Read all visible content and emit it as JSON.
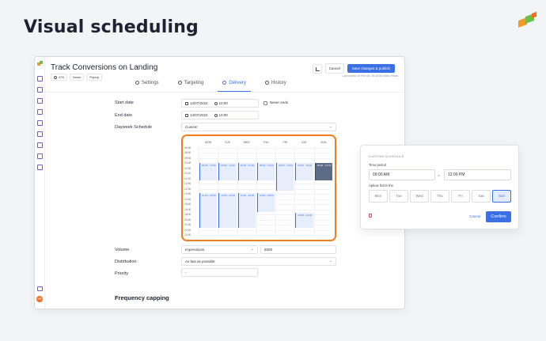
{
  "hero": {
    "title": "Visual scheduling"
  },
  "campaign": {
    "title": "Track Conversions on Landing",
    "breadcrumbs": [
      "478",
      "Home",
      "Popup"
    ],
    "cancel_label": "Cancel",
    "save_label": "Save changes & publish",
    "last_saved": "Last saved on Feb 08, 06:15 by Mario Rivas"
  },
  "tabs": [
    {
      "label": "Settings",
      "active": false
    },
    {
      "label": "Targeting",
      "active": false
    },
    {
      "label": "Delivery",
      "active": true
    },
    {
      "label": "History",
      "active": false
    }
  ],
  "form": {
    "start_date_label": "Start date",
    "start_date": "14/07/2022",
    "start_time": "10:00",
    "never_ends_label": "Never ends",
    "end_date_label": "End date",
    "end_date": "14/07/2022",
    "end_time": "10:00",
    "dayweek_label": "Dayweek Schedule",
    "dayweek_value": "Custom",
    "volume_label": "Volume",
    "volume_type": "Impressions",
    "volume_value": "5000",
    "distribution_label": "Distribution",
    "distribution_value": "As fast as possible",
    "priority_label": "Priority",
    "priority_value": "-"
  },
  "schedule": {
    "days": [
      "MON",
      "TUE",
      "WED",
      "THU",
      "FRI",
      "SAT",
      "SUN"
    ],
    "times": [
      "00:00",
      "06:00",
      "09:00",
      "10:00",
      "10:30",
      "11:00",
      "11:30",
      "12:00",
      "12:30",
      "13:00",
      "14:00",
      "15:00",
      "16:00",
      "18:00",
      "20:00",
      "21:00",
      "22:00",
      "23:00"
    ],
    "blocks": [
      {
        "day": 0,
        "label": "09:00 - 12:00",
        "start": 0.18,
        "end": 0.38
      },
      {
        "day": 1,
        "label": "09:00 - 12:00",
        "start": 0.18,
        "end": 0.38
      },
      {
        "day": 2,
        "label": "09:00 - 12:00",
        "start": 0.18,
        "end": 0.38
      },
      {
        "day": 3,
        "label": "09:00 - 12:00",
        "start": 0.18,
        "end": 0.38
      },
      {
        "day": 4,
        "label": "09:00 - 13:00",
        "start": 0.18,
        "end": 0.5
      },
      {
        "day": 5,
        "label": "09:00 - 12:00",
        "start": 0.18,
        "end": 0.38
      },
      {
        "day": 6,
        "label": "09:00 - 12:00",
        "start": 0.18,
        "end": 0.38,
        "selected": true
      },
      {
        "day": 0,
        "label": "14:00 - 22:00",
        "start": 0.53,
        "end": 0.93
      },
      {
        "day": 1,
        "label": "14:00 - 22:00",
        "start": 0.53,
        "end": 0.93
      },
      {
        "day": 2,
        "label": "14:00 - 22:00",
        "start": 0.53,
        "end": 0.93
      },
      {
        "day": 3,
        "label": "14:00 - 18:00",
        "start": 0.53,
        "end": 0.75
      },
      {
        "day": 5,
        "label": "18:00 - 22:00",
        "start": 0.75,
        "end": 0.93
      }
    ]
  },
  "frequency": {
    "title": "Frequency capping"
  },
  "modal": {
    "title": "CUSTOM SCHEDULE",
    "time_period_label": "Time period",
    "from_time": "09:00 AM",
    "to_label": "to",
    "to_time": "12:00 PM",
    "apply_label": "Aplicar fichín the",
    "days": [
      "Mon",
      "Tue",
      "Wed",
      "Thu",
      "Fri",
      "Sat",
      "Sun"
    ],
    "selected_day": "Sun",
    "cancel_label": "Cancel",
    "confirm_label": "Confirm"
  },
  "colors": {
    "accent": "#3b6fe4",
    "highlight": "#f07e1f",
    "danger": "#e05252"
  }
}
